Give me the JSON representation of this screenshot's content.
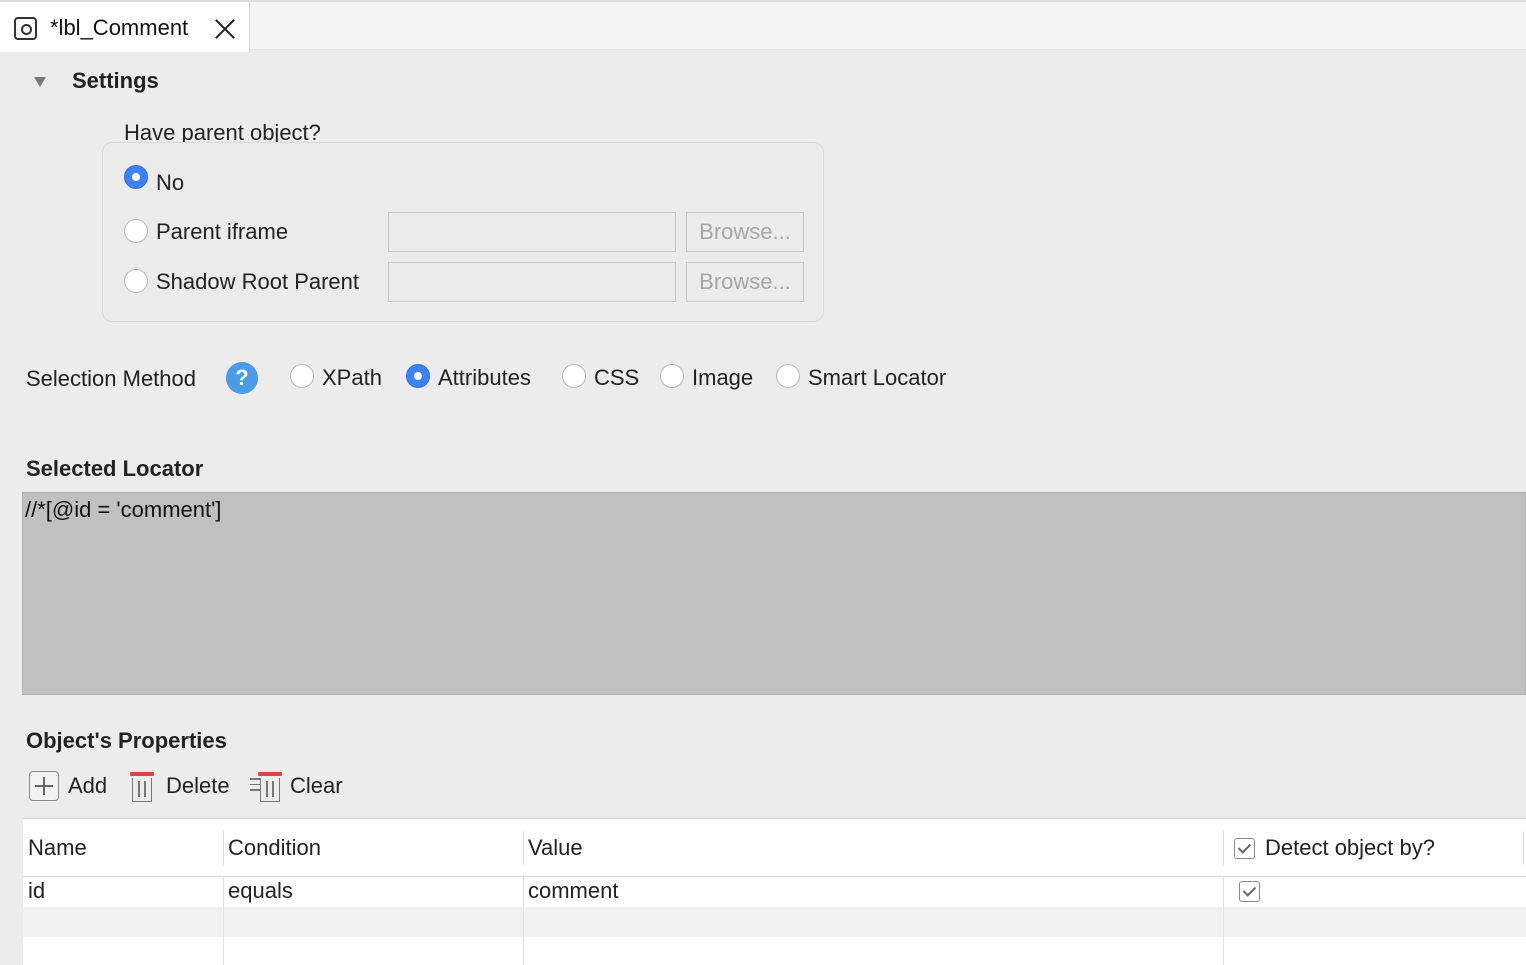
{
  "tab": {
    "title": "*lbl_Comment"
  },
  "settings": {
    "title": "Settings",
    "parent_question": "Have parent object?",
    "options": [
      {
        "label": "No",
        "selected": true
      },
      {
        "label": "Parent iframe",
        "selected": false,
        "field_value": "",
        "browse_label": "Browse..."
      },
      {
        "label": "Shadow Root Parent",
        "selected": false,
        "field_value": "",
        "browse_label": "Browse..."
      }
    ]
  },
  "selection_method": {
    "label": "Selection Method",
    "help": "?",
    "options": [
      {
        "label": "XPath",
        "selected": false
      },
      {
        "label": "Attributes",
        "selected": true
      },
      {
        "label": "CSS",
        "selected": false
      },
      {
        "label": "Image",
        "selected": false
      },
      {
        "label": "Smart Locator",
        "selected": false
      }
    ]
  },
  "selected_locator": {
    "title": "Selected Locator",
    "value": "//*[@id = 'comment']"
  },
  "properties": {
    "title": "Object's Properties",
    "toolbar": {
      "add": "Add",
      "delete": "Delete",
      "clear": "Clear"
    },
    "columns": [
      "Name",
      "Condition",
      "Value",
      "Detect object by?"
    ],
    "header_detect_checked": true,
    "rows": [
      {
        "name": "id",
        "condition": "equals",
        "value": "comment",
        "detect": true
      }
    ]
  },
  "colors": {
    "accent": "#3b82f6",
    "help_icon": "#4a9be8",
    "locator_bg": "#c0c0c0",
    "panel_bg": "#ececec"
  }
}
